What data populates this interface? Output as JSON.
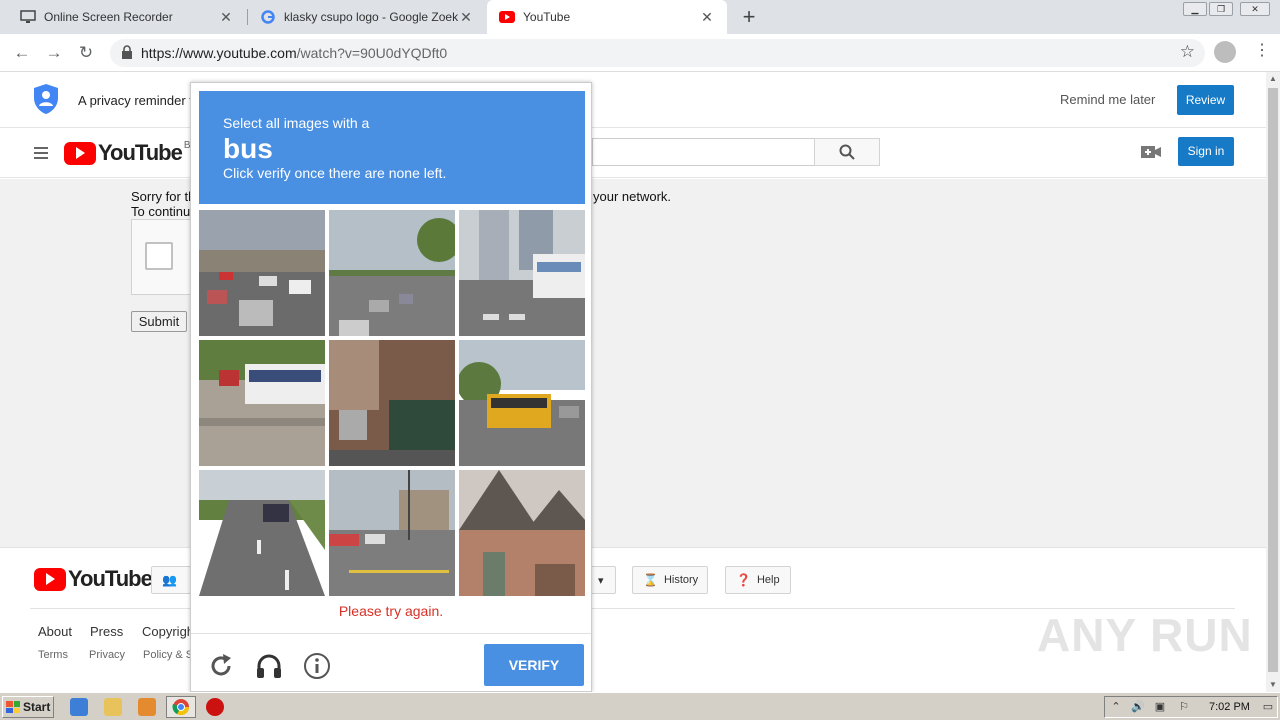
{
  "browser": {
    "tabs": [
      {
        "label": "Online Screen Recorder",
        "icon": "monitor-icon"
      },
      {
        "label": "klasky csupo logo - Google Zoeken",
        "icon": "google-g-icon"
      },
      {
        "label": "YouTube",
        "icon": "youtube-icon"
      }
    ],
    "url_host": "https://www.youtube.com",
    "url_path": "/watch?v=90U0dYQDft0"
  },
  "privacy": {
    "message": "A privacy reminder f",
    "remind_label": "Remind me later",
    "review_label": "Review"
  },
  "header": {
    "logo_text": "YouTube",
    "country_code": "BE",
    "signin_label": "Sign in"
  },
  "content": {
    "sorry_line1": "Sorry for th",
    "sorry_line2": "To continu",
    "sorry_right": "your network.",
    "submit_label": "Submit"
  },
  "captcha": {
    "instruction": "Select all images with a",
    "target": "bus",
    "hint": "Click verify once there are none left.",
    "error": "Please try again.",
    "verify_label": "VERIFY",
    "tiles": [
      "highway-overpass",
      "road-intersection",
      "city-bus-street",
      "bus-on-road",
      "car-parking",
      "school-bus",
      "highway-car",
      "intersection-traffic-light",
      "brick-house"
    ]
  },
  "footer": {
    "logo_text": "YouTube",
    "buttons": {
      "history": "History",
      "help": "Help"
    },
    "links": [
      "About",
      "Press",
      "Copyrigh"
    ],
    "sublinks": [
      "Terms",
      "Privacy",
      "Policy & S"
    ],
    "watermark": "ANY RUN"
  },
  "taskbar": {
    "start_label": "Start",
    "clock": "7:02 PM"
  },
  "colors": {
    "accent": "#167ac6",
    "captcha_blue": "#4a90e2",
    "error_red": "#d93025",
    "youtube_red": "#ff0000"
  }
}
